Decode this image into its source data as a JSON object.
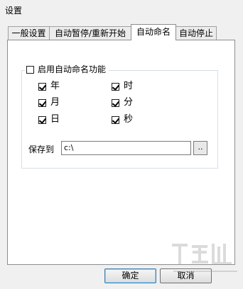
{
  "window": {
    "title": "设置"
  },
  "tabs": [
    {
      "label": "一般设置",
      "active": false
    },
    {
      "label": "自动暂停/重新开始",
      "active": false
    },
    {
      "label": "自动命名",
      "active": true
    },
    {
      "label": "自动停止",
      "active": false
    }
  ],
  "auto_naming": {
    "enable_label": "启用自动命名功能",
    "enable_checked": false,
    "options": [
      {
        "label": "年",
        "checked": true
      },
      {
        "label": "时",
        "checked": true
      },
      {
        "label": "月",
        "checked": true
      },
      {
        "label": "分",
        "checked": true
      },
      {
        "label": "日",
        "checked": true
      },
      {
        "label": "秒",
        "checked": true
      }
    ],
    "save_to_label": "保存到",
    "save_path": "c:\\",
    "browse_label": ".."
  },
  "buttons": {
    "ok": "确定",
    "cancel": "取消"
  },
  "colors": {
    "panel_bg": "#ffffff",
    "window_bg": "#f0f0f0",
    "default_button_border": "#3c7fb1"
  }
}
